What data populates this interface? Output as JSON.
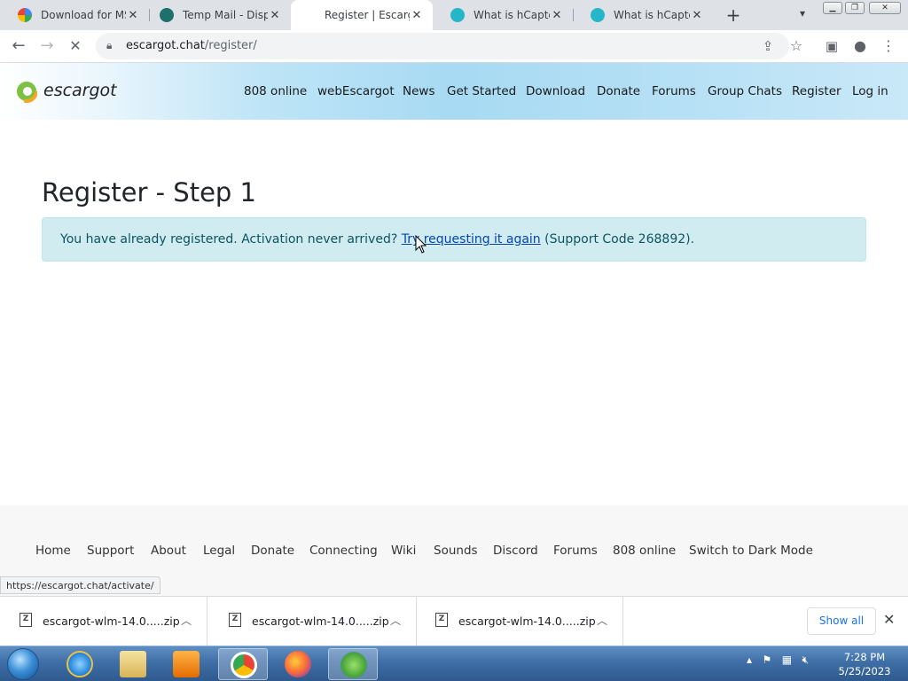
{
  "browser": {
    "tabs": [
      {
        "title": "Download for MSN",
        "active": false
      },
      {
        "title": "Temp Mail - Dispo",
        "active": false
      },
      {
        "title": "Register | Escargo",
        "active": true
      },
      {
        "title": "What is hCaptcha",
        "active": false
      },
      {
        "title": "What is hCaptcha",
        "active": false
      }
    ],
    "url_host": "escargot.chat",
    "url_path": "/register/"
  },
  "site": {
    "logo_text": "escargot",
    "nav": [
      "808 online",
      "webEscargot",
      "News",
      "Get Started",
      "Download",
      "Donate",
      "Forums",
      "Group Chats",
      "Register",
      "Log in"
    ]
  },
  "main": {
    "title": "Register - Step 1",
    "alert_prefix": "You have already registered. Activation never arrived? ",
    "alert_link": "Try requesting it again",
    "alert_suffix": " (Support Code 268892)."
  },
  "footer": {
    "links": [
      "Home",
      "Support",
      "About",
      "Legal",
      "Donate",
      "Connecting",
      "Wiki",
      "Sounds",
      "Discord",
      "Forums",
      "808 online",
      "Switch to Dark Mode"
    ]
  },
  "status_url": "https://escargot.chat/activate/",
  "downloads": {
    "items": [
      "escargot-wlm-14.0.....zip",
      "escargot-wlm-14.0.....zip",
      "escargot-wlm-14.0.....zip"
    ],
    "show_all": "Show all"
  },
  "taskbar": {
    "time": "7:28 PM",
    "date": "5/25/2023"
  },
  "colors": {
    "alert_bg": "#d1ecf1",
    "alert_text": "#0c5460",
    "link": "#0645ad",
    "taskbar": "#3f6fa6"
  }
}
